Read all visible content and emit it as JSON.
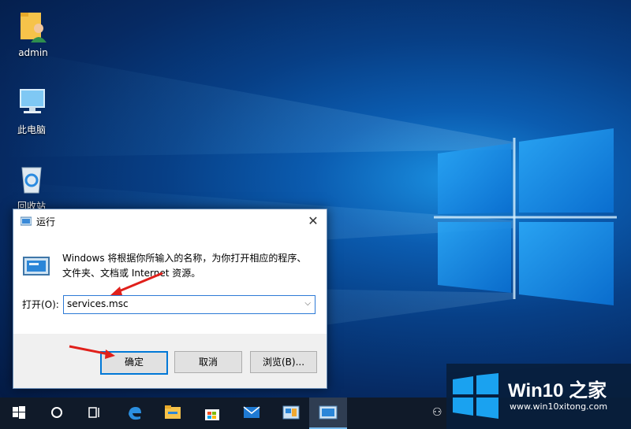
{
  "desktop": {
    "icons": [
      {
        "label": "admin"
      },
      {
        "label": "此电脑"
      },
      {
        "label": "回收站"
      }
    ]
  },
  "run_dialog": {
    "title": "运行",
    "close_glyph": "✕",
    "description": "Windows 将根据你所输入的名称，为你打开相应的程序、文件夹、文档或 Internet 资源。",
    "open_label": "打开(O):",
    "input_value": "services.msc",
    "buttons": {
      "ok": "确定",
      "cancel": "取消",
      "browse": "浏览(B)..."
    }
  },
  "taskbar": {
    "items": [
      "start-icon",
      "cortana-icon",
      "task-view-icon",
      "edge-icon",
      "file-explorer-icon",
      "store-icon",
      "mail-icon",
      "control-panel-icon",
      "run-icon"
    ],
    "active": "run-icon"
  },
  "watermark": {
    "brand": "Win10 之家",
    "url": "www.win10xitong.com"
  },
  "colors": {
    "accent": "#0078d7",
    "taskbar": "#101a29",
    "arrow": "#e0201b"
  }
}
